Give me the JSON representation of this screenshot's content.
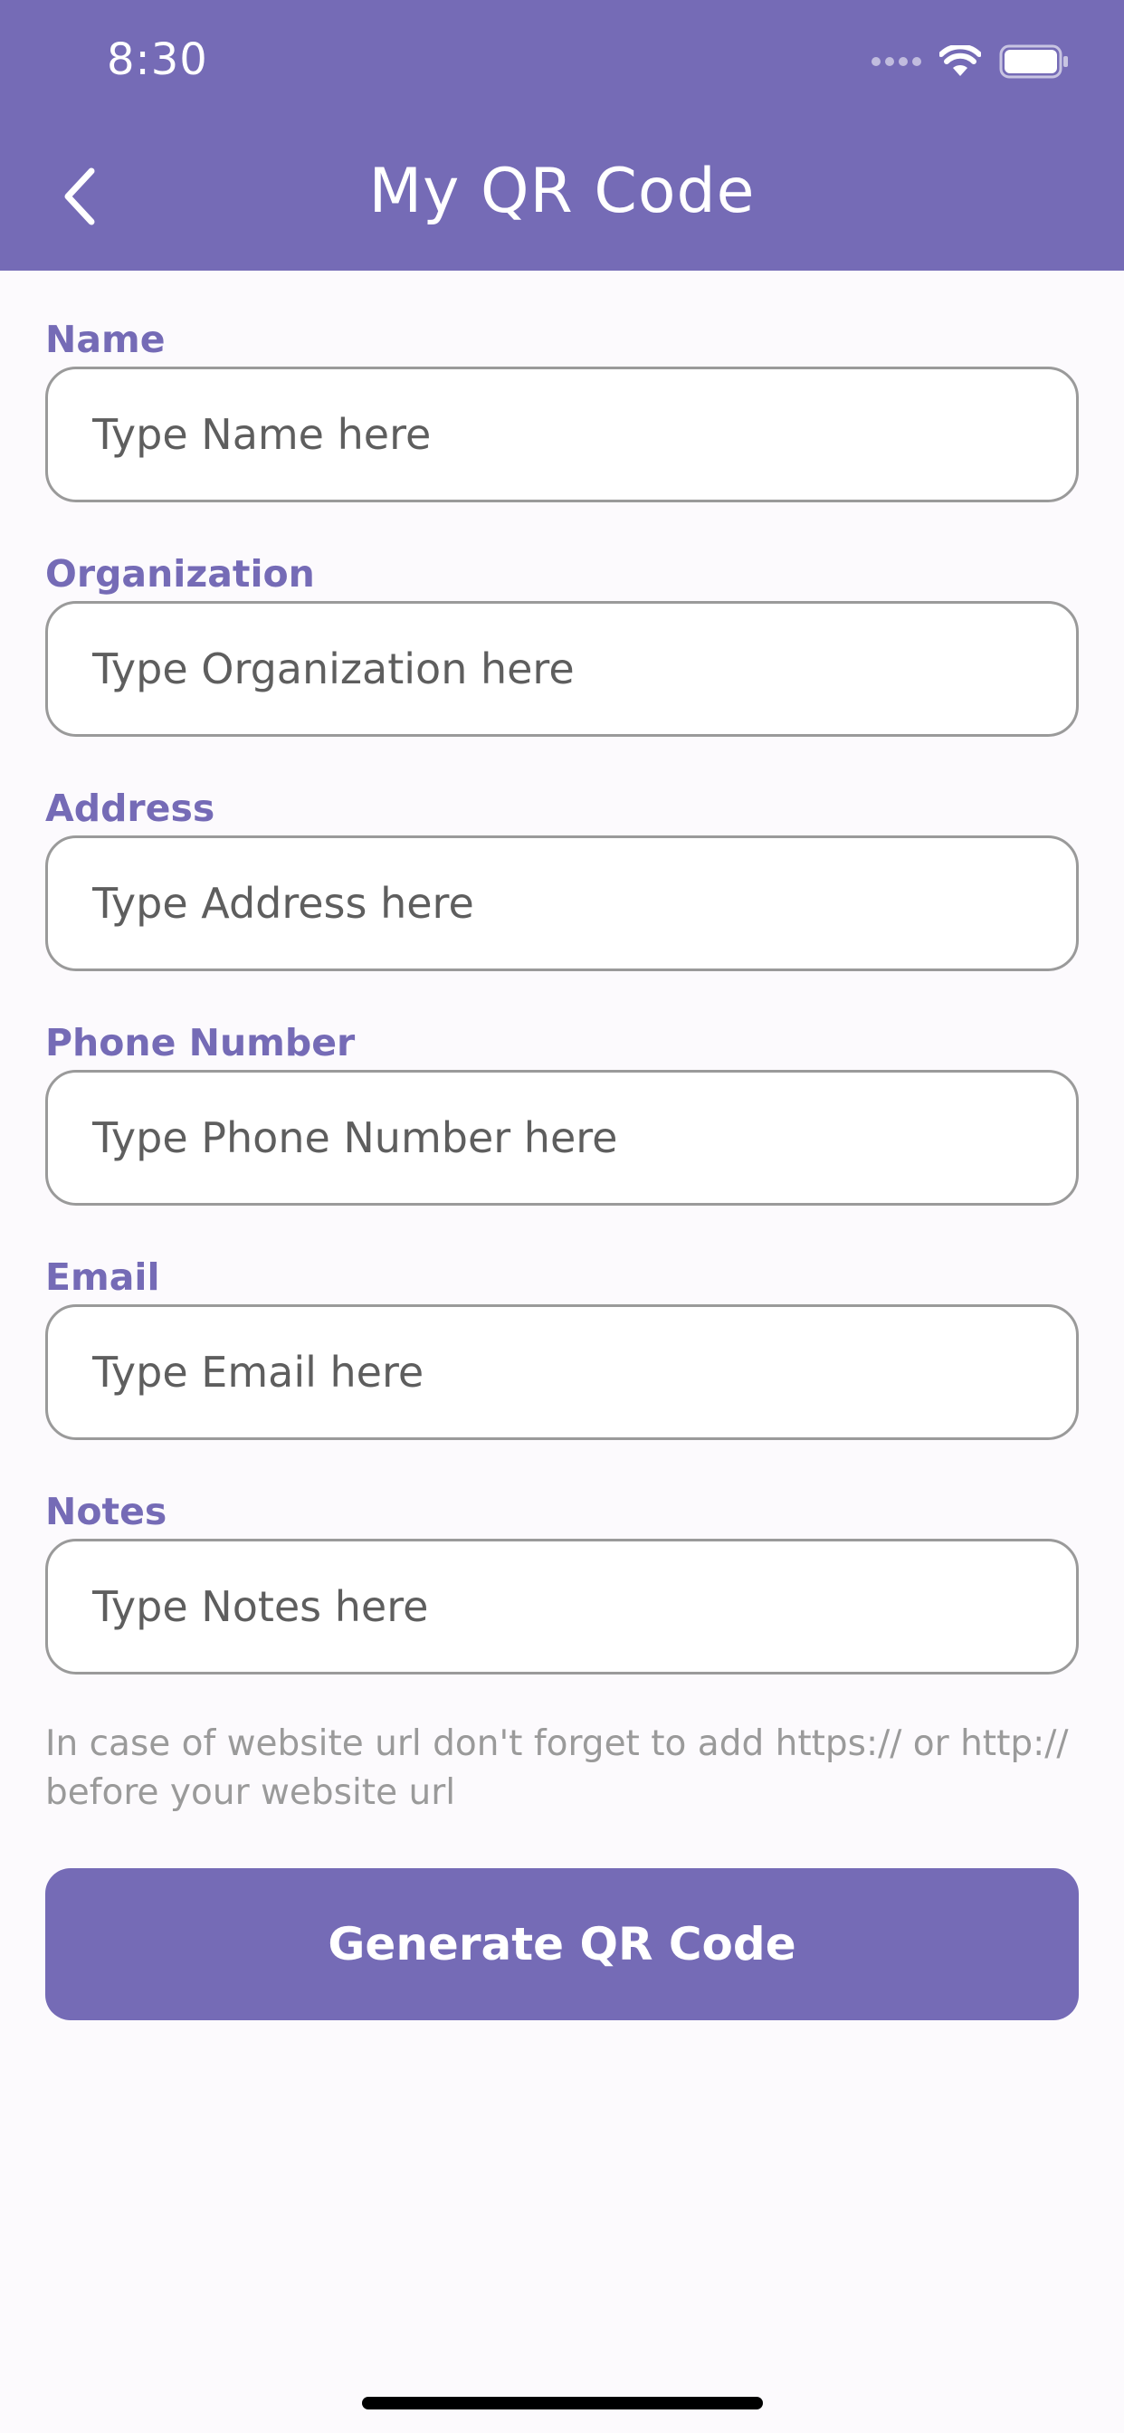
{
  "status_bar": {
    "time": "8:30",
    "icons": [
      "signal-dots-icon",
      "wifi-icon",
      "battery-icon"
    ]
  },
  "header": {
    "title": "My QR Code",
    "back_icon": "chevron-left-icon",
    "background_color": "#756BB6"
  },
  "form": {
    "fields": [
      {
        "label": "Name",
        "placeholder": "Type Name here",
        "value": ""
      },
      {
        "label": "Organization",
        "placeholder": "Type Organization here",
        "value": ""
      },
      {
        "label": "Address",
        "placeholder": "Type Address here",
        "value": ""
      },
      {
        "label": "Phone Number",
        "placeholder": "Type Phone Number here",
        "value": ""
      },
      {
        "label": "Email",
        "placeholder": "Type Email here",
        "value": ""
      },
      {
        "label": "Notes",
        "placeholder": "Type Notes here",
        "value": ""
      }
    ],
    "hint": "In case of website url don't forget to add https:// or http:// before your website url",
    "submit_label": "Generate QR Code"
  },
  "colors": {
    "accent": "#756BB6",
    "background": "#FCFAFD",
    "input_border": "#9A9A9A",
    "hint_text": "#9A9A9A"
  }
}
